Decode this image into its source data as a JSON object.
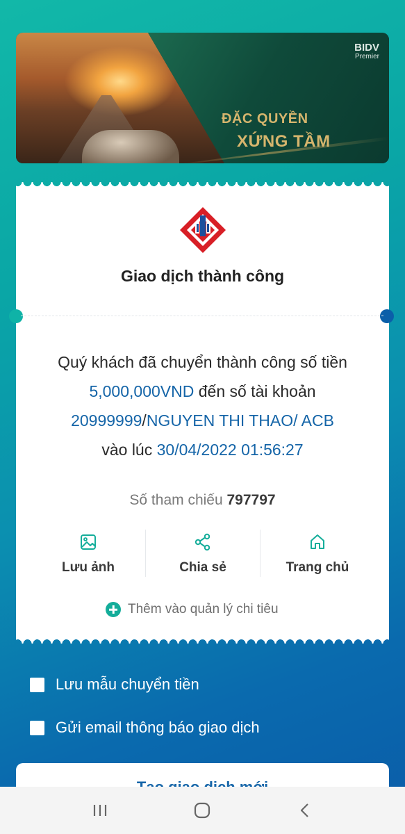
{
  "banner": {
    "brand": "BIDV",
    "brand_sub": "Premier",
    "slogan_line1": "ĐẶC QUYỀN",
    "slogan_line2": "XỨNG TẦM"
  },
  "receipt": {
    "title": "Giao dịch thành công",
    "message": {
      "p1": "Quý khách đã chuyển thành công số tiền ",
      "amount": "5,000,000VND",
      "p2": " đến số tài khoản ",
      "account": "20999999",
      "p3": "/",
      "recipient": "NGUYEN THI THAO/ ACB",
      "p4": " vào lúc ",
      "datetime": "30/04/2022 01:56:27"
    },
    "reference_label": "Số tham chiếu",
    "reference_value": "797797",
    "actions": [
      {
        "label": "Lưu ảnh",
        "icon": "image-icon"
      },
      {
        "label": "Chia sẻ",
        "icon": "share-icon"
      },
      {
        "label": "Trang chủ",
        "icon": "home-icon"
      }
    ],
    "add_expense_label": "Thêm vào quản lý chi tiêu"
  },
  "options": {
    "save_template": "Lưu mẫu chuyển tiền",
    "send_email": "Gửi email thông báo giao dịch"
  },
  "bottom_button": "Tạo giao dịch mới",
  "colors": {
    "accent": "#1565a8",
    "teal": "#14ad9a",
    "gold": "#d6b56d"
  }
}
